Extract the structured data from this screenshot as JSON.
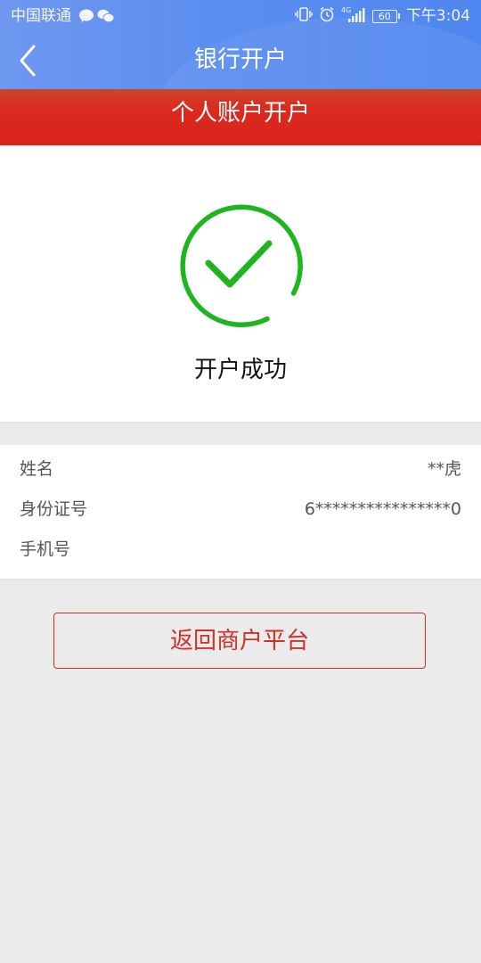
{
  "status_bar": {
    "carrier": "中国联通",
    "network_label": "4G",
    "battery": "60",
    "time": "下午3:04"
  },
  "nav": {
    "title": "银行开户"
  },
  "banner": {
    "title": "个人账户开户"
  },
  "result": {
    "message": "开户成功"
  },
  "info": {
    "rows": [
      {
        "label": "姓名",
        "value": "**虎"
      },
      {
        "label": "身份证号",
        "value": "6****************0"
      },
      {
        "label": "手机号",
        "value": ""
      }
    ]
  },
  "actions": {
    "return_label": "返回商户平台"
  },
  "colors": {
    "header_blue": "#5b8ef0",
    "banner_red": "#d9241c",
    "success_green": "#1fb51f",
    "button_red": "#d4302a"
  }
}
